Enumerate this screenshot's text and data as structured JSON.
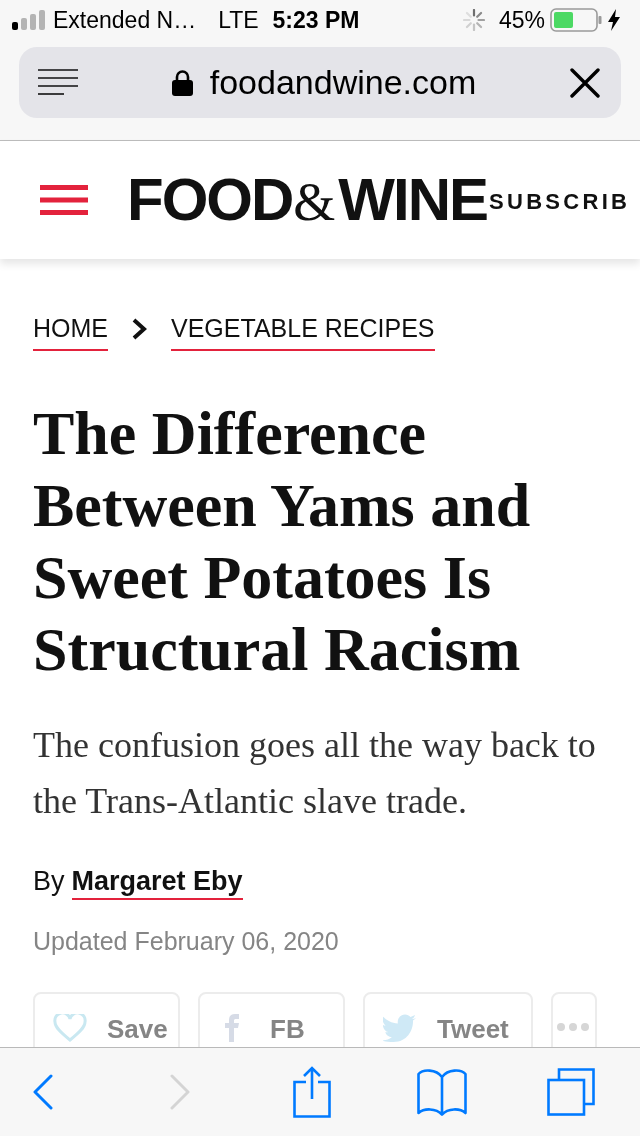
{
  "status_bar": {
    "carrier": "Extended N…",
    "network": "LTE",
    "time": "5:23 PM",
    "battery": "45%"
  },
  "address_bar": {
    "url": "foodandwine.com"
  },
  "site_header": {
    "logo": {
      "left": "FOOD",
      "ampersand": "&",
      "right": "WINE"
    },
    "subscribe": "SUBSCRIB"
  },
  "breadcrumbs": [
    {
      "label": "HOME"
    },
    {
      "label": "VEGETABLE RECIPES"
    }
  ],
  "article": {
    "title": "The Difference Between Yams and Sweet Potatoes Is Structural Racism",
    "dek": "The confusion goes all the way back to the Trans-Atlantic slave trade.",
    "byline_prefix": "By",
    "author": "Margaret Eby",
    "updated": "Updated February 06, 2020"
  },
  "share_buttons": [
    {
      "kind": "save",
      "label": "Save"
    },
    {
      "kind": "fb",
      "label": "FB"
    },
    {
      "kind": "tweet",
      "label": "Tweet"
    },
    {
      "kind": "more"
    }
  ],
  "toolbar": [
    {
      "kind": "back",
      "disabled": false
    },
    {
      "kind": "forward",
      "disabled": true
    },
    {
      "kind": "share",
      "disabled": false
    },
    {
      "kind": "bookmarks",
      "disabled": false
    },
    {
      "kind": "tabs",
      "disabled": false
    }
  ]
}
